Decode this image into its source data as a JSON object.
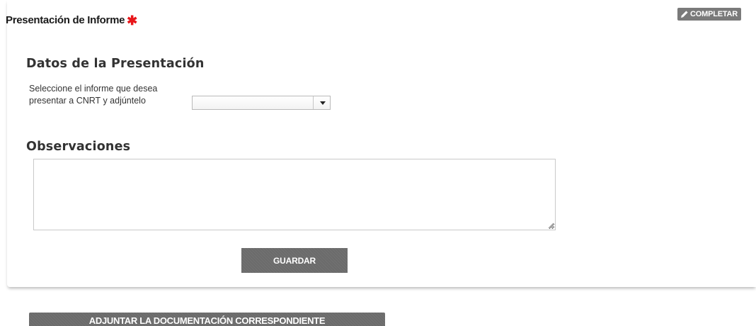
{
  "header": {
    "title": "Presentación de Informe",
    "required_marker": "✱",
    "complete_label": "COMPLETAR"
  },
  "datos": {
    "heading": "Datos de la Presentación",
    "informe_label": "Seleccione el informe que desea presentar a CNRT y adjúntelo",
    "informe_value": ""
  },
  "observaciones": {
    "heading": "Observaciones",
    "value": ""
  },
  "actions": {
    "save_label": "GUARDAR",
    "attach_label": "ADJUNTAR LA DOCUMENTACIÓN CORRESPONDIENTE"
  },
  "icons": {
    "complete": "pencil-icon",
    "select": "caret-down-icon",
    "textarea": "resize-grip-icon"
  },
  "colors": {
    "required": "#e8161a",
    "button": "#6b6b6b",
    "complete_button": "#7a7a7a"
  }
}
